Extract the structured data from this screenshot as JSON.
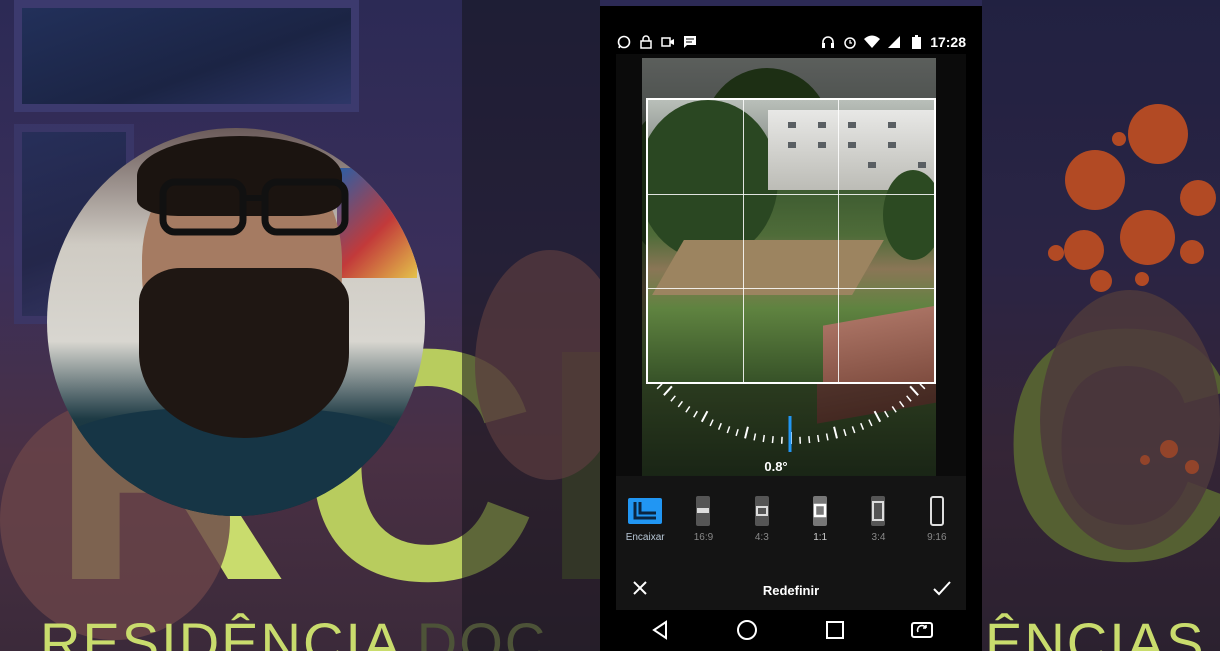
{
  "status_bar": {
    "time": "17:28",
    "left_icons": [
      "whatsapp-icon",
      "lock-icon",
      "video-icon",
      "message-icon"
    ],
    "right_icons": [
      "headphones-icon",
      "alarm-icon",
      "wifi-icon",
      "signal-icon",
      "battery-icon"
    ]
  },
  "editor": {
    "angle": "0.8°",
    "rotation_degrees": 0.8
  },
  "ratios": [
    {
      "id": "fit",
      "label": "Encaixar",
      "active": true
    },
    {
      "id": "16-9",
      "label": "16:9",
      "active": false
    },
    {
      "id": "4-3",
      "label": "4:3",
      "active": false
    },
    {
      "id": "1-1",
      "label": "1:1",
      "active": false
    },
    {
      "id": "3-4",
      "label": "3:4",
      "active": false
    },
    {
      "id": "9-16",
      "label": "9:16",
      "active": false
    }
  ],
  "actions": {
    "reset_label": "Redefinir",
    "cancel_icon": "close-icon",
    "confirm_icon": "check-icon"
  },
  "navigation": [
    "back-icon",
    "home-icon",
    "recents-icon",
    "rotate-icon"
  ],
  "background": {
    "banner_text_bright": "RESIDÊNCIA",
    "banner_text_dim": "DOC",
    "banner_text_right": "ÊNCIAS"
  },
  "colors": {
    "accent": "#2196f3",
    "brand_green": "#c9dc6d",
    "brand_orange": "#b24a24"
  }
}
